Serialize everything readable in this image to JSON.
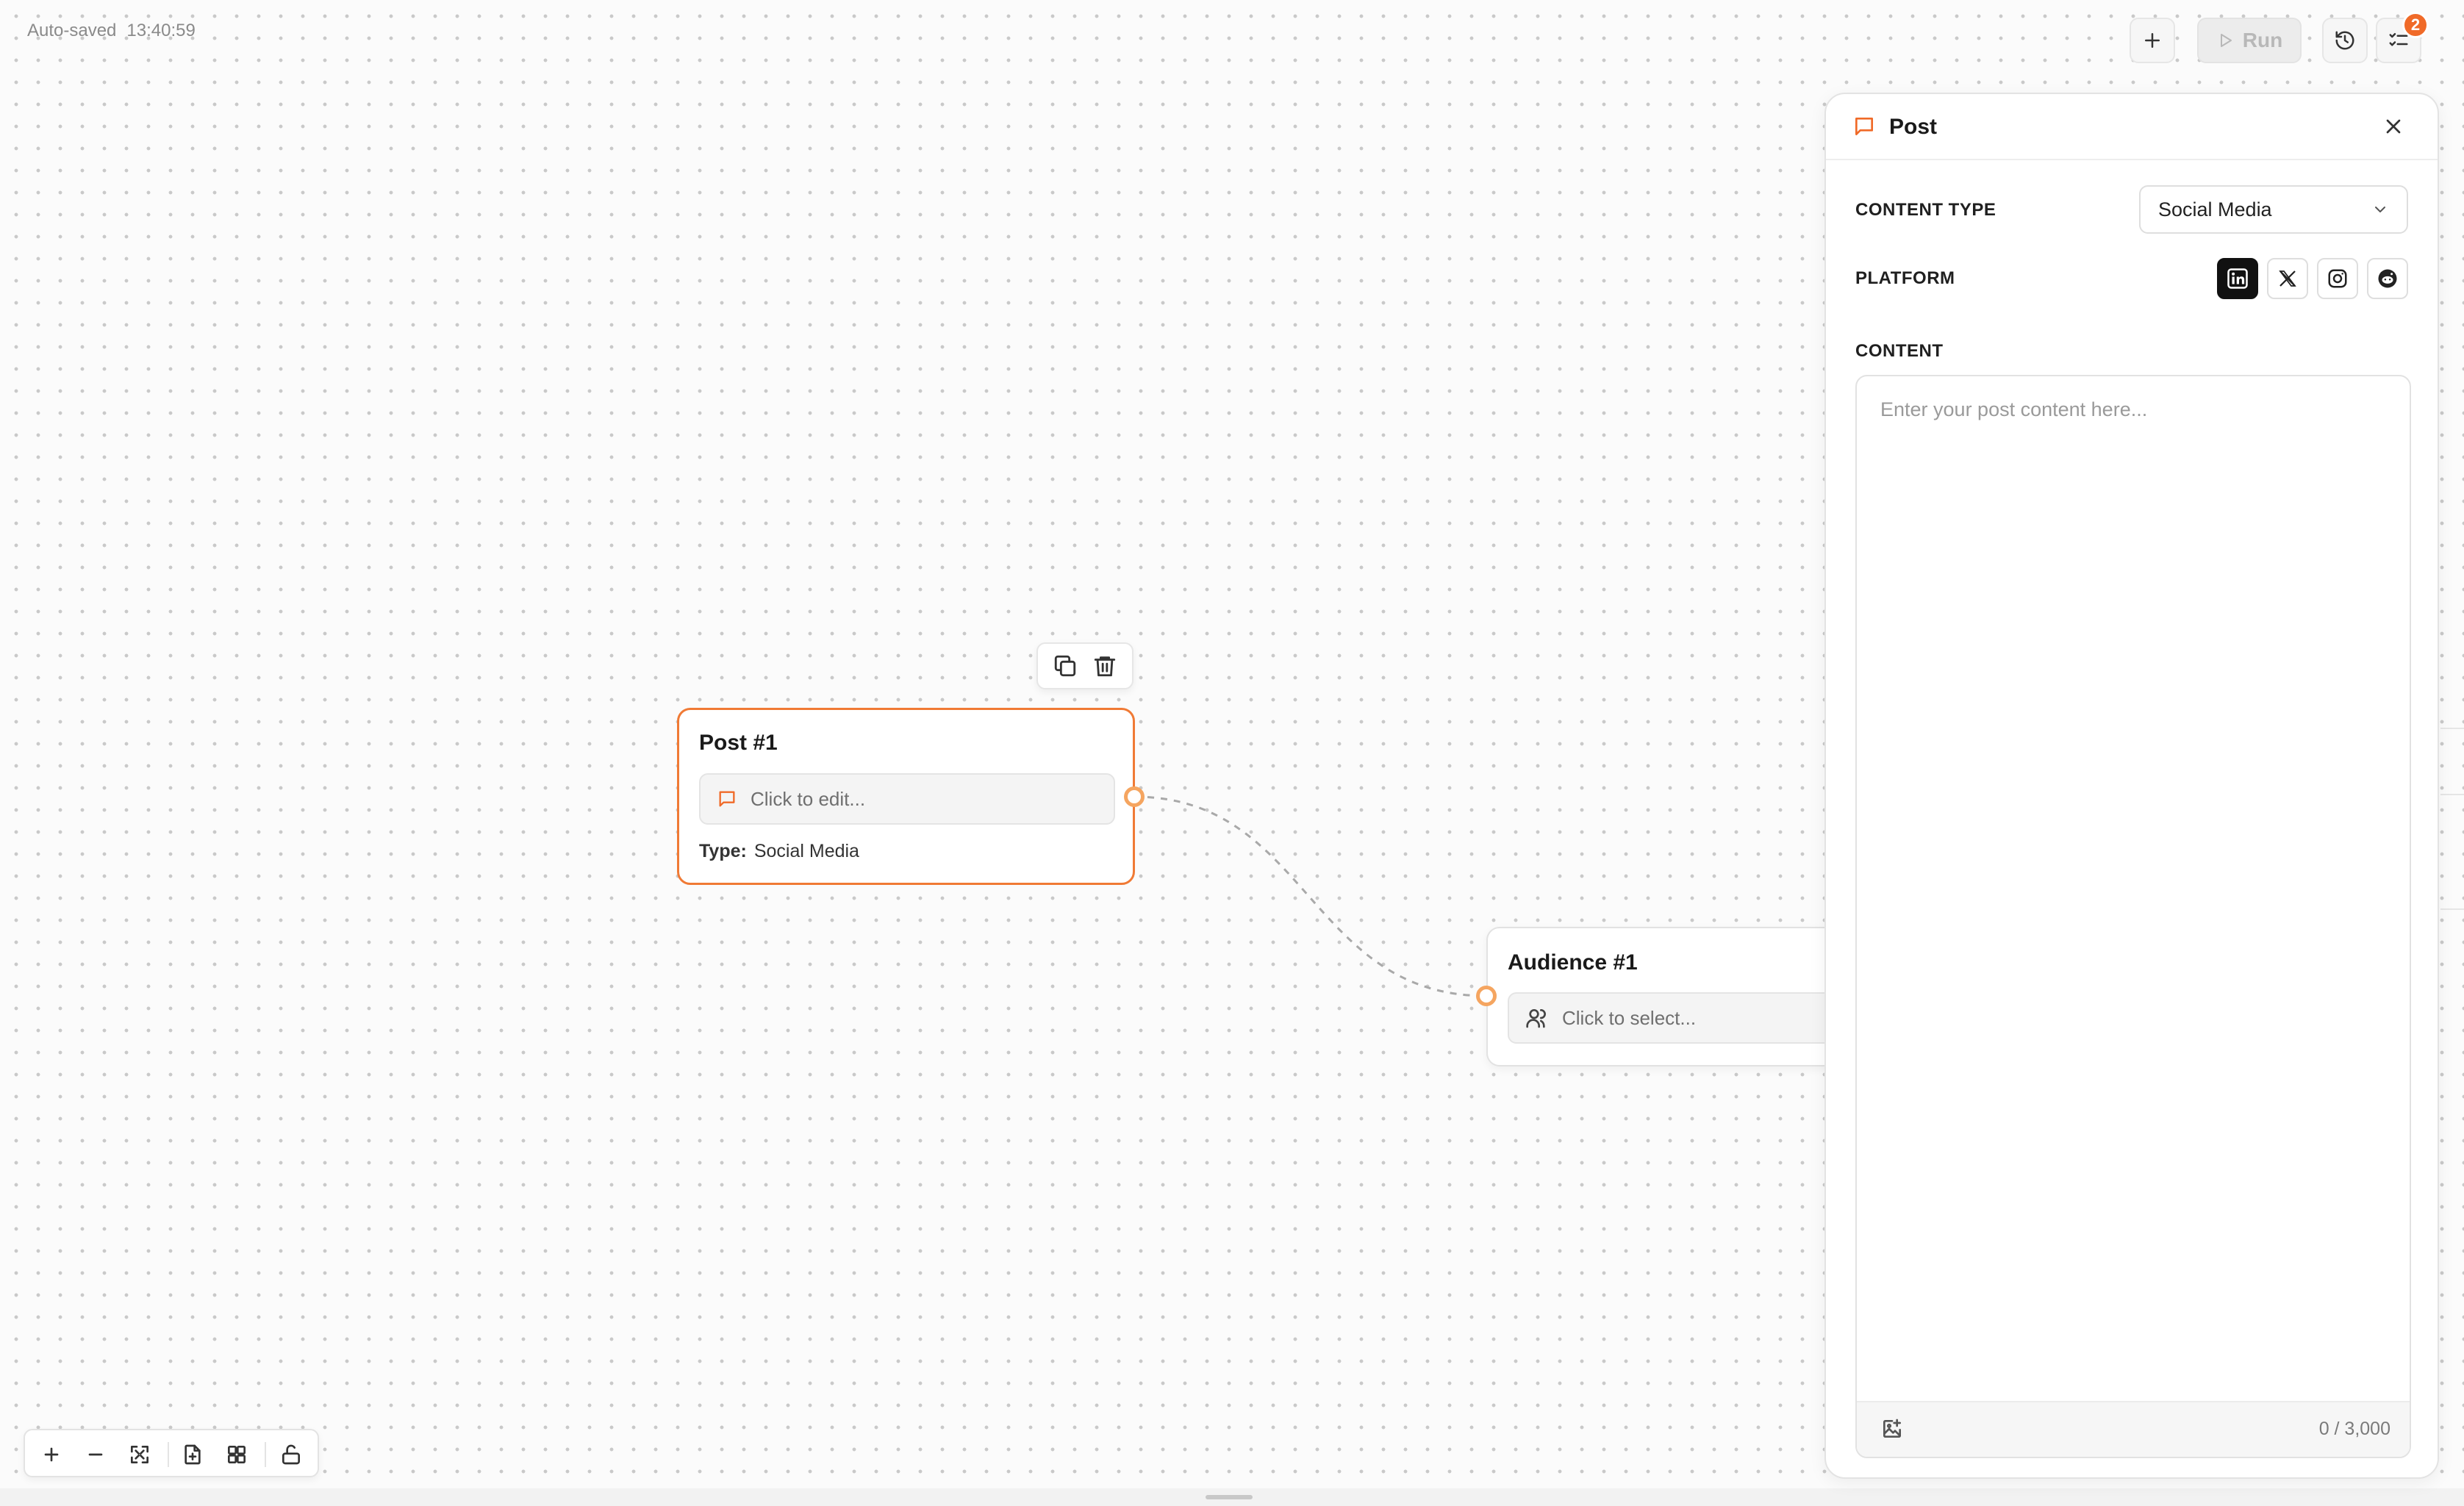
{
  "status": {
    "autosave_label": "Auto-saved",
    "autosave_time": "13:40:59"
  },
  "topbar": {
    "run_label": "Run",
    "notification_count": "2"
  },
  "nodes": {
    "post": {
      "title": "Post #1",
      "placeholder": "Click to edit...",
      "type_label": "Type:",
      "type_value": "Social Media"
    },
    "audience": {
      "title": "Audience #1",
      "placeholder": "Click to select..."
    }
  },
  "panel": {
    "title": "Post",
    "content_type_label": "CONTENT TYPE",
    "content_type_value": "Social Media",
    "platform_label": "PLATFORM",
    "platforms": [
      {
        "name": "LinkedIn",
        "icon": "linkedin-icon",
        "selected": true
      },
      {
        "name": "X",
        "icon": "x-icon",
        "selected": false
      },
      {
        "name": "Instagram",
        "icon": "instagram-icon",
        "selected": false
      },
      {
        "name": "Reddit",
        "icon": "reddit-icon",
        "selected": false
      }
    ],
    "content_label": "CONTENT",
    "content_placeholder": "Enter your post content here...",
    "char_count": "0 / 3,000"
  },
  "colors": {
    "accent": "#f06a28",
    "node_border": "#f07a35",
    "handle": "#f5a560"
  }
}
